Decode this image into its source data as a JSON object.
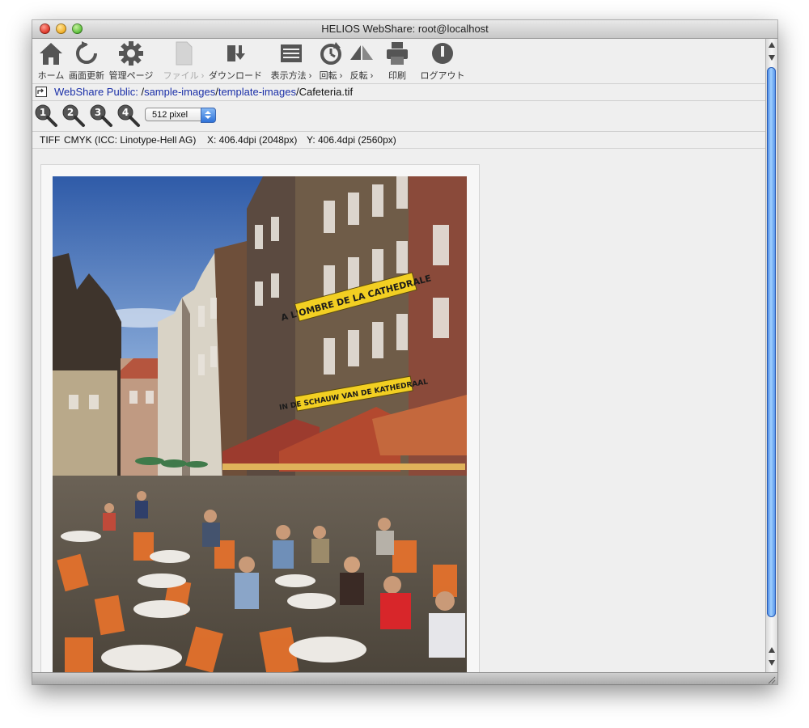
{
  "window": {
    "title": "HELIOS WebShare: root@localhost"
  },
  "toolbar": {
    "items": [
      {
        "label": "ホーム",
        "icon": "home-icon"
      },
      {
        "label": "画面更新",
        "icon": "refresh-icon"
      },
      {
        "label": "管理ページ",
        "icon": "gear-icon"
      },
      {
        "label": "ファイル ›",
        "icon": "file-icon",
        "disabled": true
      },
      {
        "label": "ダウンロード",
        "icon": "download-icon"
      },
      {
        "label": "表示方法 ›",
        "icon": "view-icon"
      },
      {
        "label": "回転 ›",
        "icon": "rotate-icon"
      },
      {
        "label": "反転 ›",
        "icon": "flip-icon"
      },
      {
        "label": "印刷",
        "icon": "printer-icon"
      },
      {
        "label": "ログアウト",
        "icon": "logout-icon"
      }
    ]
  },
  "path": {
    "root": "WebShare Public:",
    "sep1": " /",
    "dir1": "sample-images",
    "sep2": "/",
    "dir2": "template-images",
    "sep3": "/",
    "file": "Cafeteria.tif"
  },
  "zoom": {
    "buttons": [
      "1",
      "2",
      "3",
      "4"
    ],
    "selected": "512 pixel"
  },
  "info": {
    "format": "TIFF",
    "colorspace": "CMYK (ICC: Linotype-Hell AG)",
    "x_res": "X: 406.4dpi (2048px)",
    "y_res": "Y: 406.4dpi (2560px)"
  },
  "preview": {
    "sign_top": "A L'OMBRE DE LA CATHEDRALE",
    "sign_bottom": "IN DE SCHAUW VAN DE KATHEDRAAL"
  },
  "colors": {
    "link": "#1a2fa8",
    "scroll_thumb": "#3a7be0"
  }
}
